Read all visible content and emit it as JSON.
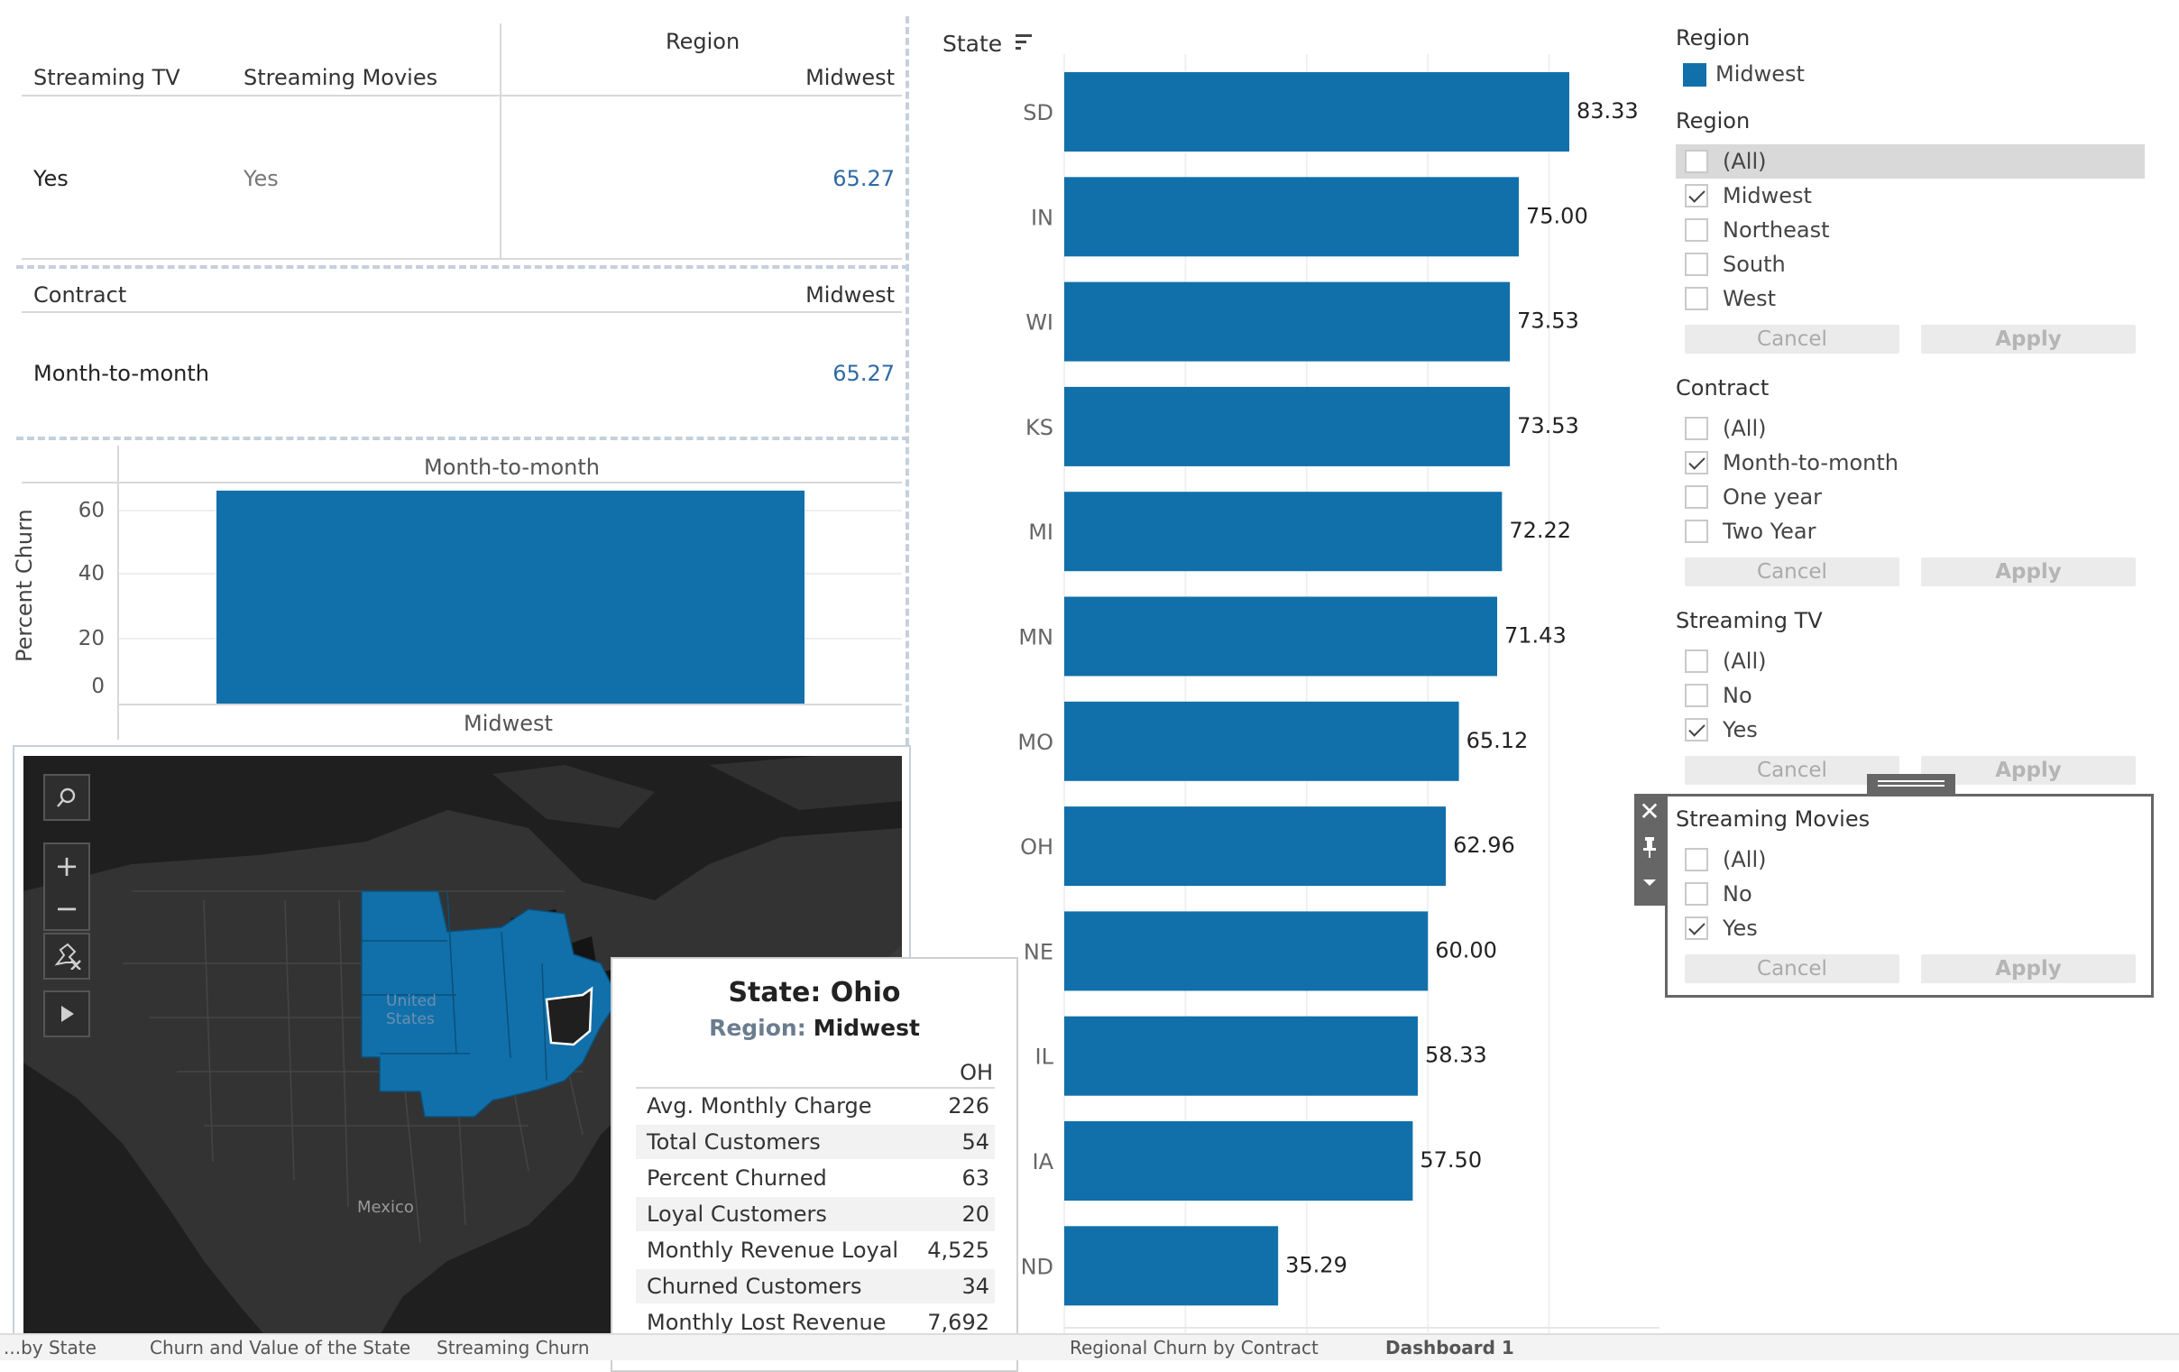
{
  "crosstab1": {
    "col1_header": "Streaming TV",
    "col2_header": "Streaming Movies",
    "region_header": "Region",
    "region_value": "Midwest",
    "row_tv": "Yes",
    "row_movies": "Yes",
    "value": "65.27"
  },
  "crosstab2": {
    "col_header": "Contract",
    "region_value": "Midwest",
    "row_label": "Month-to-month",
    "value": "65.27"
  },
  "small_chart": {
    "top_label": "Month-to-month",
    "bottom_label": "Midwest",
    "ylabel": "Percent Churn",
    "ticks": [
      "60",
      "40",
      "20",
      "0"
    ]
  },
  "map": {
    "label_us": "United States",
    "label_mexico": "Mexico"
  },
  "tooltip": {
    "title": "State: Ohio",
    "region_label": "Region:",
    "region_value": "Midwest",
    "col_header": "OH",
    "rows": [
      {
        "label": "Avg. Monthly Charge",
        "value": "226"
      },
      {
        "label": "Total Customers",
        "value": "54"
      },
      {
        "label": "Percent Churned",
        "value": "63"
      },
      {
        "label": "Loyal Customers",
        "value": "20"
      },
      {
        "label": "Monthly Revenue Loyal",
        "value": "4,525"
      },
      {
        "label": "Churned Customers",
        "value": "34"
      },
      {
        "label": "Monthly Lost Revenue",
        "value": "7,692"
      }
    ]
  },
  "bar_chart": {
    "header": "State"
  },
  "chart_data": [
    {
      "type": "bar",
      "orientation": "horizontal",
      "xlabel": "",
      "ylabel": "State",
      "categories": [
        "SD",
        "IN",
        "WI",
        "KS",
        "MI",
        "MN",
        "MO",
        "OH",
        "NE",
        "IL",
        "IA",
        "ND"
      ],
      "values": [
        83.33,
        75.0,
        73.53,
        73.53,
        72.22,
        71.43,
        65.12,
        62.96,
        60.0,
        58.33,
        57.5,
        35.29
      ],
      "value_labels": [
        "83.33",
        "75.00",
        "73.53",
        "73.53",
        "72.22",
        "71.43",
        "65.12",
        "62.96",
        "60.00",
        "58.33",
        "57.50",
        "35.29"
      ],
      "xlim": [
        0,
        100
      ],
      "color": "#1170aa"
    },
    {
      "type": "bar",
      "categories": [
        "Midwest"
      ],
      "values": [
        65.27
      ],
      "ylabel": "Percent Churn",
      "ylim": [
        0,
        68
      ],
      "color": "#1170aa"
    }
  ],
  "filters": {
    "legend_title": "Region",
    "legend_item": "Midwest",
    "legend_color": "#1170aa",
    "cancel": "Cancel",
    "apply": "Apply",
    "region": {
      "title": "Region",
      "items": [
        {
          "label": "(All)",
          "checked": false
        },
        {
          "label": "Midwest",
          "checked": true
        },
        {
          "label": "Northeast",
          "checked": false
        },
        {
          "label": "South",
          "checked": false
        },
        {
          "label": "West",
          "checked": false
        }
      ]
    },
    "contract": {
      "title": "Contract",
      "items": [
        {
          "label": "(All)",
          "checked": false
        },
        {
          "label": "Month-to-month",
          "checked": true
        },
        {
          "label": "One year",
          "checked": false
        },
        {
          "label": "Two Year",
          "checked": false
        }
      ]
    },
    "streaming_tv": {
      "title": "Streaming TV",
      "items": [
        {
          "label": "(All)",
          "checked": false
        },
        {
          "label": "No",
          "checked": false
        },
        {
          "label": "Yes",
          "checked": true
        }
      ]
    },
    "streaming_movies": {
      "title": "Streaming Movies",
      "items": [
        {
          "label": "(All)",
          "checked": false
        },
        {
          "label": "No",
          "checked": false
        },
        {
          "label": "Yes",
          "checked": true
        }
      ]
    }
  },
  "tabs": [
    "...by State",
    "Churn and Value of the State",
    "Streaming Churn",
    "Regional Churn by Contract",
    "Dashboard 1"
  ]
}
